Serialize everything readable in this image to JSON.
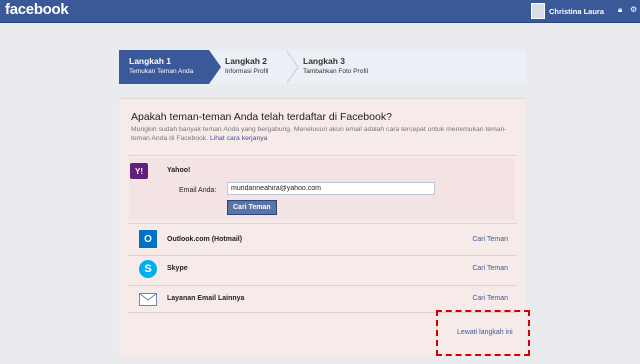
{
  "topbar": {
    "logo": "facebook",
    "user_name": "Christina Laura",
    "icons": [
      "lock-icon",
      "gear-icon"
    ],
    "bg_color": "#3b5998"
  },
  "steps": [
    {
      "title": "Langkah 1",
      "subtitle": "Temukan Teman Anda",
      "active": true
    },
    {
      "title": "Langkah 2",
      "subtitle": "Informasi Profil",
      "active": false
    },
    {
      "title": "Langkah 3",
      "subtitle": "Tambahkan Foto Profil",
      "active": false
    }
  ],
  "main": {
    "heading": "Apakah teman-teman Anda telah terdaftar di Facebook?",
    "description": "Mungkin sudah banyak teman Anda yang bergabung. Menelusuri akun email adalah cara tercepat untuk menemukan teman-teman Anda di Facebook.",
    "how_link": "Lihat cara kerjanya"
  },
  "yahoo": {
    "icon": "yahoo-icon",
    "name": "Yahoo!",
    "email_label": "Email Anda:",
    "email_value": "muridanneahira@yahoo.com",
    "button": "Cari Teman"
  },
  "providers": [
    {
      "icon": "outlook-icon",
      "name": "Outlook.com (Hotmail)",
      "link": "Cari Teman"
    },
    {
      "icon": "skype-icon",
      "name": "Skype",
      "link": "Cari Teman"
    },
    {
      "icon": "mail-icon",
      "name": "Layanan Email Lainnya",
      "link": "Cari Teman"
    }
  ],
  "skip_link": "Lewati langkah ini",
  "highlight_color": "#d40000"
}
